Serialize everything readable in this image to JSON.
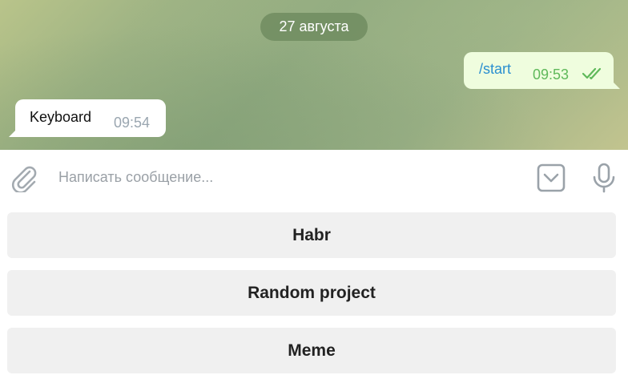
{
  "chat": {
    "date_label": "27 августа",
    "messages": [
      {
        "direction": "outgoing",
        "text": "/start",
        "time": "09:53",
        "status": "read"
      },
      {
        "direction": "incoming",
        "text": "Keyboard",
        "time": "09:54"
      }
    ]
  },
  "composer": {
    "placeholder": "Написать сообщение...",
    "attach_icon": "paperclip-icon",
    "keyboard_icon": "keyboard-toggle-icon",
    "mic_icon": "microphone-icon"
  },
  "reply_keyboard": {
    "buttons": [
      "Habr",
      "Random project",
      "Meme"
    ]
  },
  "colors": {
    "outgoing_bubble": "#effdde",
    "link_text": "#2a8fd0",
    "read_ticks": "#5fb95a",
    "date_pill": "#708c60",
    "key_bg": "#f0f0f0"
  }
}
